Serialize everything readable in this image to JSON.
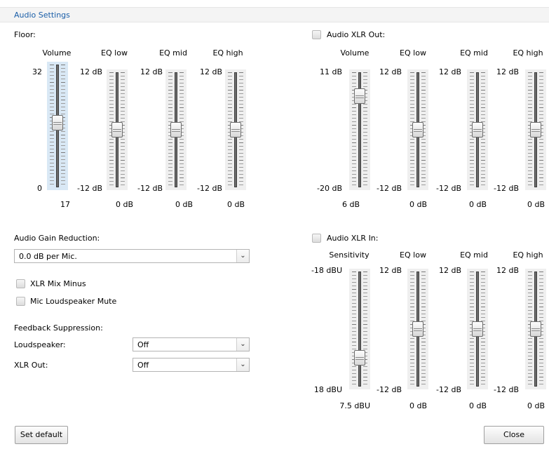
{
  "dialog_title": "Audio Settings",
  "floor": {
    "label": "Floor:",
    "sliders": [
      {
        "header": "Volume",
        "max_label": "32",
        "min_label": "0",
        "value": "17",
        "level": 0.53
      },
      {
        "header": "EQ low",
        "max_label": "12 dB",
        "min_label": "-12 dB",
        "value": "0 dB",
        "level": 0.5
      },
      {
        "header": "EQ mid",
        "max_label": "12 dB",
        "min_label": "-12 dB",
        "value": "0 dB",
        "level": 0.5
      },
      {
        "header": "EQ high",
        "max_label": "12 dB",
        "min_label": "-12 dB",
        "value": "0 dB",
        "level": 0.5
      }
    ]
  },
  "xlr_out": {
    "label": "Audio XLR Out:",
    "sliders": [
      {
        "header": "Volume",
        "max_label": "11 dB",
        "min_label": "-20 dB",
        "value": "6 dB",
        "level": 0.84
      },
      {
        "header": "EQ low",
        "max_label": "12 dB",
        "min_label": "-12 dB",
        "value": "0 dB",
        "level": 0.5
      },
      {
        "header": "EQ mid",
        "max_label": "12 dB",
        "min_label": "-12 dB",
        "value": "0 dB",
        "level": 0.5
      },
      {
        "header": "EQ high",
        "max_label": "12 dB",
        "min_label": "-12 dB",
        "value": "0 dB",
        "level": 0.5
      }
    ]
  },
  "xlr_in": {
    "label": "Audio XLR In:",
    "sliders": [
      {
        "header": "Sensitivity",
        "max_label": "-18 dBU",
        "min_label": "18 dBU",
        "value": "7.5 dBU",
        "level": 0.21
      },
      {
        "header": "EQ low",
        "max_label": "12 dB",
        "min_label": "-12 dB",
        "value": "0 dB",
        "level": 0.5
      },
      {
        "header": "EQ mid",
        "max_label": "12 dB",
        "min_label": "-12 dB",
        "value": "0 dB",
        "level": 0.5
      },
      {
        "header": "EQ high",
        "max_label": "12 dB",
        "min_label": "-12 dB",
        "value": "0 dB",
        "level": 0.5
      }
    ]
  },
  "gain_reduction": {
    "label": "Audio Gain Reduction:",
    "value": "0.0 dB per Mic."
  },
  "xlr_mix_minus": "XLR Mix Minus",
  "mic_loudspeaker_mute": "Mic Loudspeaker Mute",
  "feedback": {
    "label": "Feedback Suppression:",
    "loudspeaker_label": "Loudspeaker:",
    "loudspeaker_value": "Off",
    "xlr_out_label": "XLR Out:",
    "xlr_out_value": "Off"
  },
  "buttons": {
    "set_default": "Set default",
    "close": "Close"
  },
  "icons": {
    "dropdown": "chevron-down-icon"
  }
}
